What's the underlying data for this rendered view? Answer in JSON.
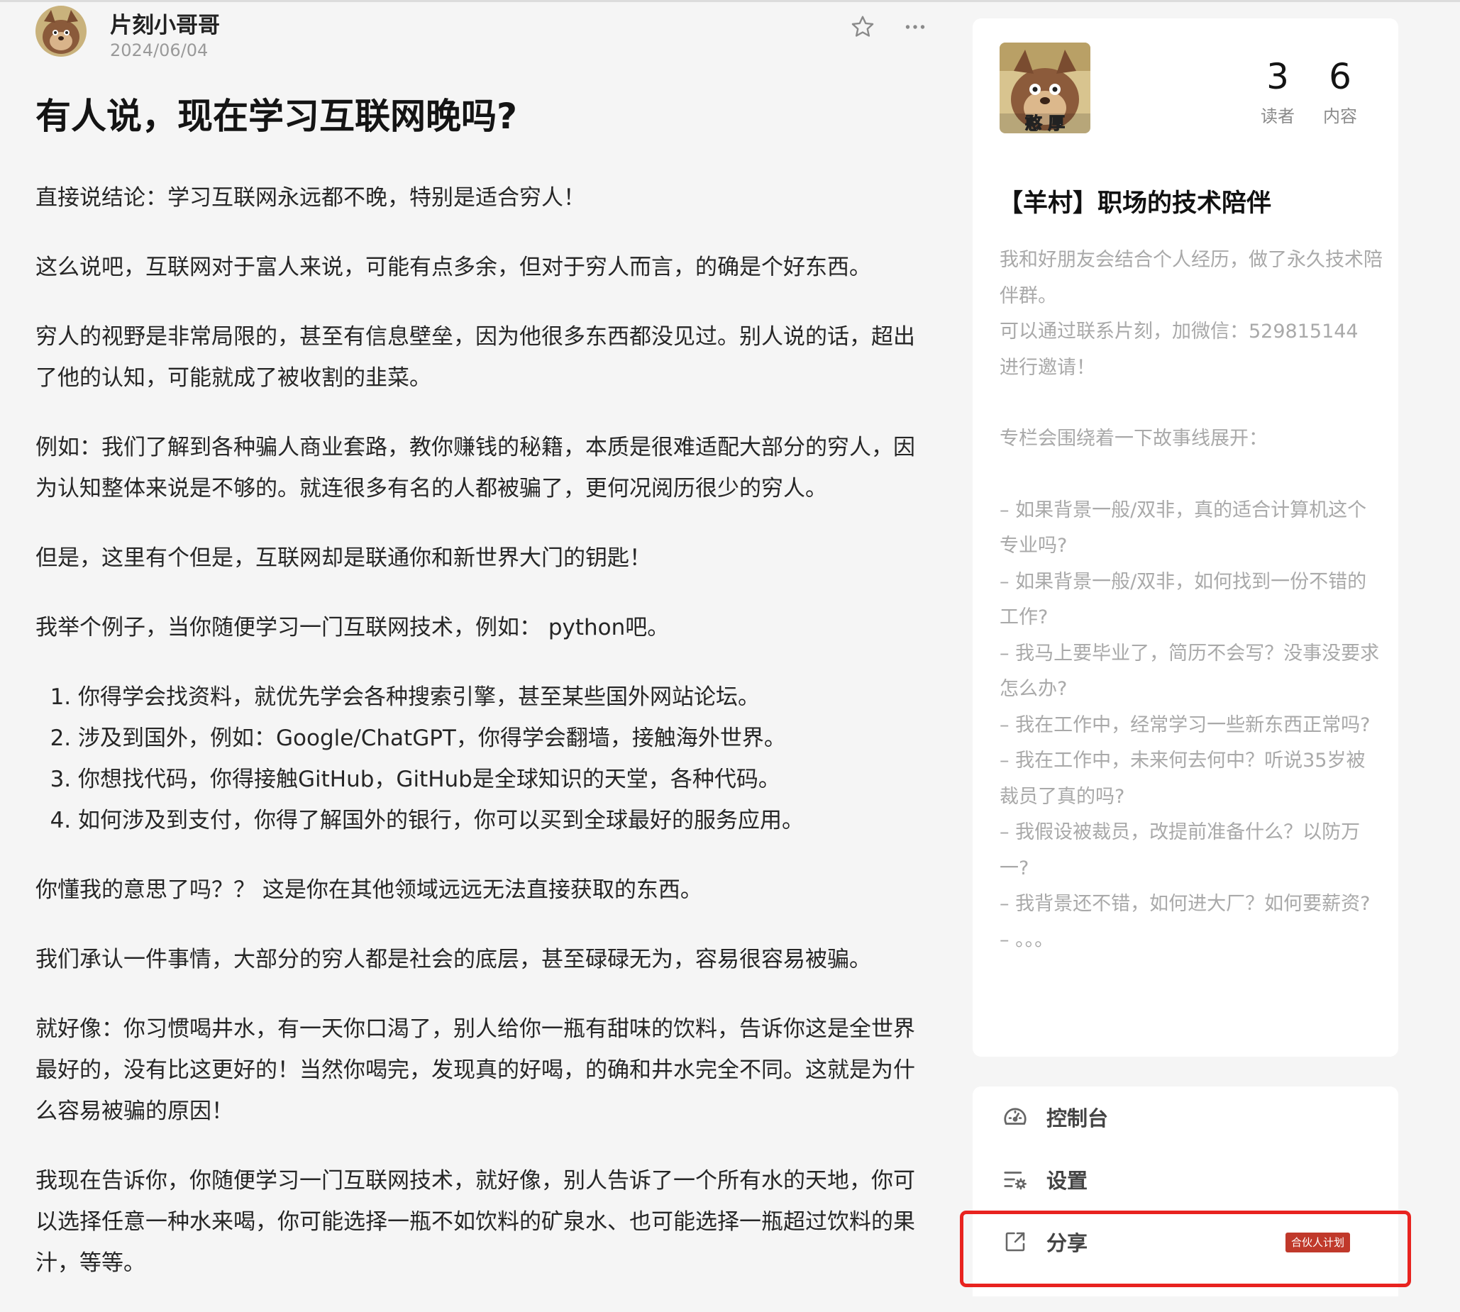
{
  "author": {
    "name": "片刻小哥哥",
    "date": "2024/06/04",
    "avatar_text": "憨 厚"
  },
  "article": {
    "title": "有人说，现在学习互联网晚吗?",
    "paragraphs": [
      "直接说结论：学习互联网永远都不晚，特别是适合穷人！",
      "这么说吧，互联网对于富人来说，可能有点多余，但对于穷人而言，的确是个好东西。",
      "穷人的视野是非常局限的，甚至有信息壁垒，因为他很多东西都没见过。别人说的话，超出了他的认知，可能就成了被收割的韭菜。",
      "例如：我们了解到各种骗人商业套路，教你赚钱的秘籍，本质是很难适配大部分的穷人，因为认知整体来说是不够的。就连很多有名的人都被骗了，更何况阅历很少的穷人。",
      "但是，这里有个但是，互联网却是联通你和新世界大门的钥匙！",
      "我举个例子，当你随便学习一门互联网技术，例如： python吧。"
    ],
    "list": [
      "你得学会找资料，就优先学会各种搜索引擎，甚至某些国外网站论坛。",
      "涉及到国外，例如：Google/ChatGPT，你得学会翻墙，接触海外世界。",
      "你想找代码，你得接触GitHub，GitHub是全球知识的天堂，各种代码。",
      "如何涉及到支付，你得了解国外的银行，你可以买到全球最好的服务应用。"
    ],
    "paragraphs_after": [
      "你懂我的意思了吗？？ 这是你在其他领域远远无法直接获取的东西。",
      "我们承认一件事情，大部分的穷人都是社会的底层，甚至碌碌无为，容易很容易被骗。",
      "就好像：你习惯喝井水，有一天你口渴了，别人给你一瓶有甜味的饮料，告诉你这是全世界最好的，没有比这更好的！当然你喝完，发现真的好喝，的确和井水完全不同。这就是为什么容易被骗的原因！",
      "我现在告诉你，你随便学习一门互联网技术，就好像，别人告诉了一个所有水的天地，你可以选择任意一种水来喝，你可能选择一瓶不如饮料的矿泉水、也可能选择一瓶超过饮料的果汁，等等。"
    ]
  },
  "column": {
    "avatar_text": "憨 厚",
    "readers_value": "3",
    "readers_label": "读者",
    "contents_value": "6",
    "contents_label": "内容",
    "title": "【羊村】职场的技术陪伴",
    "desc_intro": [
      "我和好朋友会结合个人经历，做了永久技术陪伴群。",
      "可以通过联系片刻，加微信：529815144 进行邀请！"
    ],
    "desc_lead": "专栏会围绕着一下故事线展开：",
    "desc_items": [
      "– 如果背景一般/双非，真的适合计算机这个专业吗?",
      "– 如果背景一般/双非，如何找到一份不错的工作?",
      "– 我马上要毕业了，简历不会写？没事没要求怎么办?",
      "– 我在工作中，经常学习一些新东西正常吗?",
      "– 我在工作中，未来何去何中？听说35岁被裁员了真的吗?",
      "– 我假设被裁员，改提前准备什么？以防万一?",
      "– 我背景还不错，如何进大厂？如何要薪资?",
      "– 。。。"
    ]
  },
  "menu": {
    "console_label": "控制台",
    "settings_label": "设置",
    "share_label": "分享",
    "partner_badge": "合伙人计划"
  },
  "colors": {
    "highlight": "#e8231f",
    "badge": "#c0392b",
    "muted_text": "#a9a9a9"
  }
}
